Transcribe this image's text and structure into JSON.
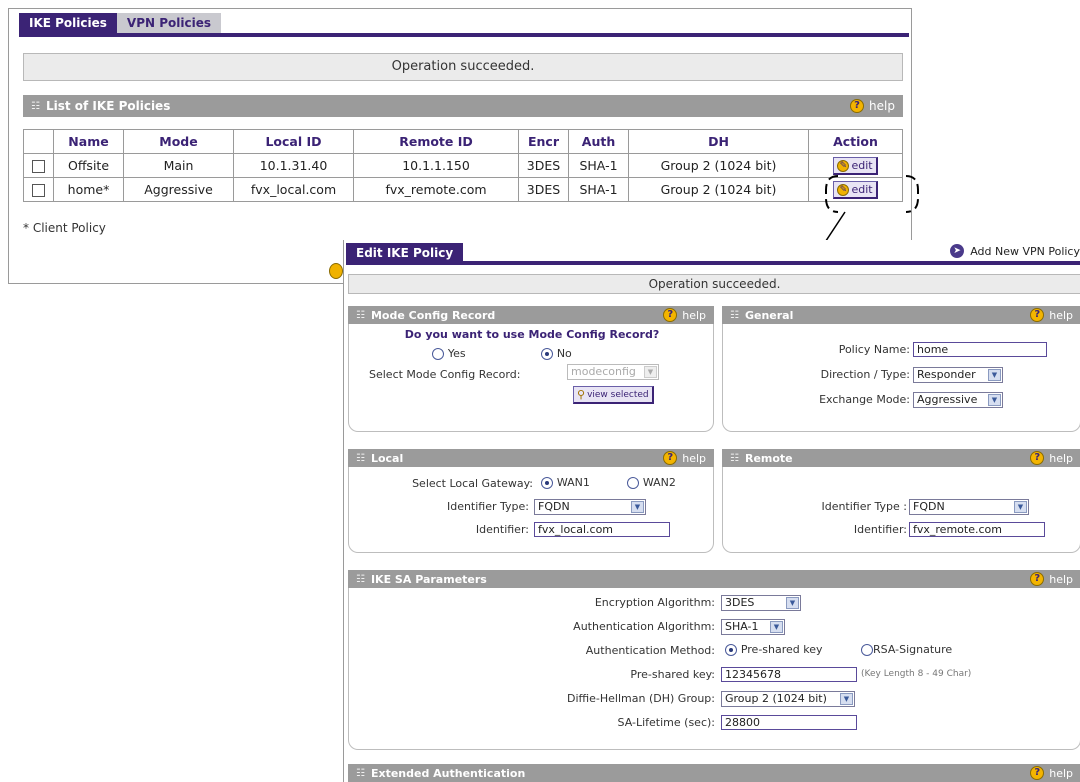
{
  "back": {
    "tabs": [
      {
        "label": "IKE Policies"
      },
      {
        "label": "VPN Policies"
      }
    ],
    "message": "Operation succeeded.",
    "list_title": "List of IKE Policies",
    "help": "help",
    "columns": [
      "Name",
      "Mode",
      "Local ID",
      "Remote ID",
      "Encr",
      "Auth",
      "DH",
      "Action"
    ],
    "rows": [
      {
        "name": "Offsite",
        "mode": "Main",
        "local_id": "10.1.31.40",
        "remote_id": "10.1.1.150",
        "encr": "3DES",
        "auth": "SHA-1",
        "dh": "Group 2 (1024 bit)",
        "action": "edit"
      },
      {
        "name": "home*",
        "mode": "Aggressive",
        "local_id": "fvx_local.com",
        "remote_id": "fvx_remote.com",
        "encr": "3DES",
        "auth": "SHA-1",
        "dh": "Group 2 (1024 bit)",
        "action": "edit"
      }
    ],
    "footnote": "* Client Policy"
  },
  "edit": {
    "tab": "Edit IKE Policy",
    "add_link": "Add New VPN Policy",
    "message": "Operation succeeded.",
    "help": "help",
    "mode_config": {
      "title": "Mode Config Record",
      "question": "Do you want to use Mode Config Record?",
      "yes": "Yes",
      "no": "No",
      "select_label": "Select Mode Config Record:",
      "select_value": "modeconfig",
      "view_btn": "view selected"
    },
    "general": {
      "title": "General",
      "policy_name_label": "Policy Name:",
      "policy_name": "home",
      "direction_label": "Direction / Type:",
      "direction": "Responder",
      "exchange_label": "Exchange Mode:",
      "exchange": "Aggressive"
    },
    "local": {
      "title": "Local",
      "gateway_label": "Select Local Gateway:",
      "wan1": "WAN1",
      "wan2": "WAN2",
      "id_type_label": "Identifier Type:",
      "id_type": "FQDN",
      "identifier_label": "Identifier:",
      "identifier": "fvx_local.com"
    },
    "remote": {
      "title": "Remote",
      "id_type_label": "Identifier Type :",
      "id_type": "FQDN",
      "identifier_label": "Identifier:",
      "identifier": "fvx_remote.com"
    },
    "ike_sa": {
      "title": "IKE SA Parameters",
      "enc_label": "Encryption Algorithm:",
      "enc": "3DES",
      "auth_label": "Authentication Algorithm:",
      "auth": "SHA-1",
      "method_label": "Authentication Method:",
      "psk_opt": "Pre-shared key",
      "rsa_opt": "RSA-Signature",
      "psk_label": "Pre-shared key:",
      "psk": "12345678",
      "psk_hint": "(Key Length 8 - 49 Char)",
      "dh_label": "Diffie-Hellman (DH) Group:",
      "dh": "Group 2 (1024 bit)",
      "lifetime_label": "SA-Lifetime (sec):",
      "lifetime": "28800"
    },
    "ext_auth": {
      "title": "Extended Authentication"
    }
  }
}
